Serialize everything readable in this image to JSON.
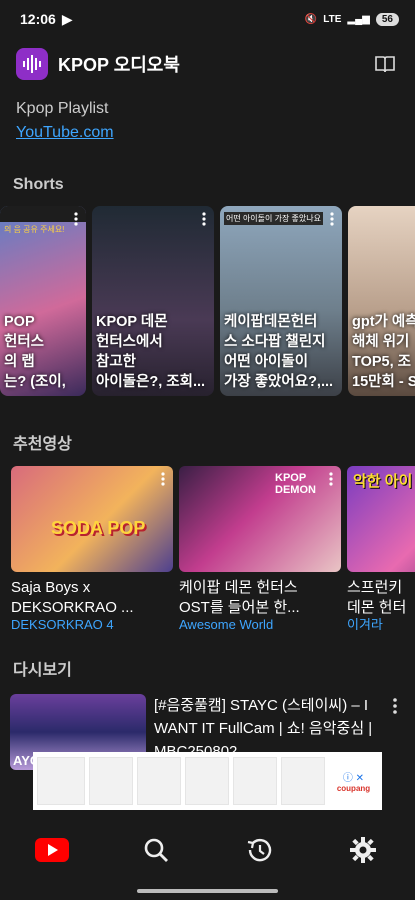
{
  "status": {
    "time": "12:06",
    "battery": "56",
    "network": "LTE"
  },
  "header": {
    "title": "KPOP 오디오북"
  },
  "playlist": {
    "name": "Kpop Playlist",
    "link": "YouTube.com"
  },
  "sections": {
    "shorts": "Shorts",
    "recommended": "추천영상",
    "watch_again": "다시보기"
  },
  "shorts": [
    {
      "title": "POP\n헌터스\n의 랩\n는? (조이,",
      "overlay": "의 음 공유 주세요!"
    },
    {
      "title": "KPOP 데몬\n헌터스에서\n참고한\n아이돌은?, 조회...",
      "overlay": ""
    },
    {
      "title": "케이팝데몬헌터\n스 소다팝 챌린지\n어떤 아이돌이\n가장 좋았어요?,...",
      "overlay": "어떤 아이돌이 가장 좋았나요"
    },
    {
      "title": "gpt가 예측\n해체 위기\nTOP5, 조\n15만회 - S",
      "overlay": ""
    }
  ],
  "recommended": [
    {
      "title": "Saja Boys x\nDEKSORKRAO ...",
      "channel": "DEKSORKRAO 4",
      "thumb_text": "SODA POP"
    },
    {
      "title": "케이팝 데몬 헌터스\nOST를 들어본 한...",
      "channel": "Awesome World",
      "thumb_text": "KPOP DEMON"
    },
    {
      "title": "스프런키\n데몬 헌터",
      "channel": "이겨라",
      "thumb_text": "악한 아이"
    }
  ],
  "watch_again": [
    {
      "title": "[#음중풀캠] STAYC (스테이씨) – I WANT IT FullCam | 쇼! 음악중심 | MBC250802",
      "thumb_text": "AYC"
    }
  ],
  "ad": {
    "brand": "coupang"
  },
  "nav": [
    "home",
    "search",
    "history",
    "settings"
  ]
}
